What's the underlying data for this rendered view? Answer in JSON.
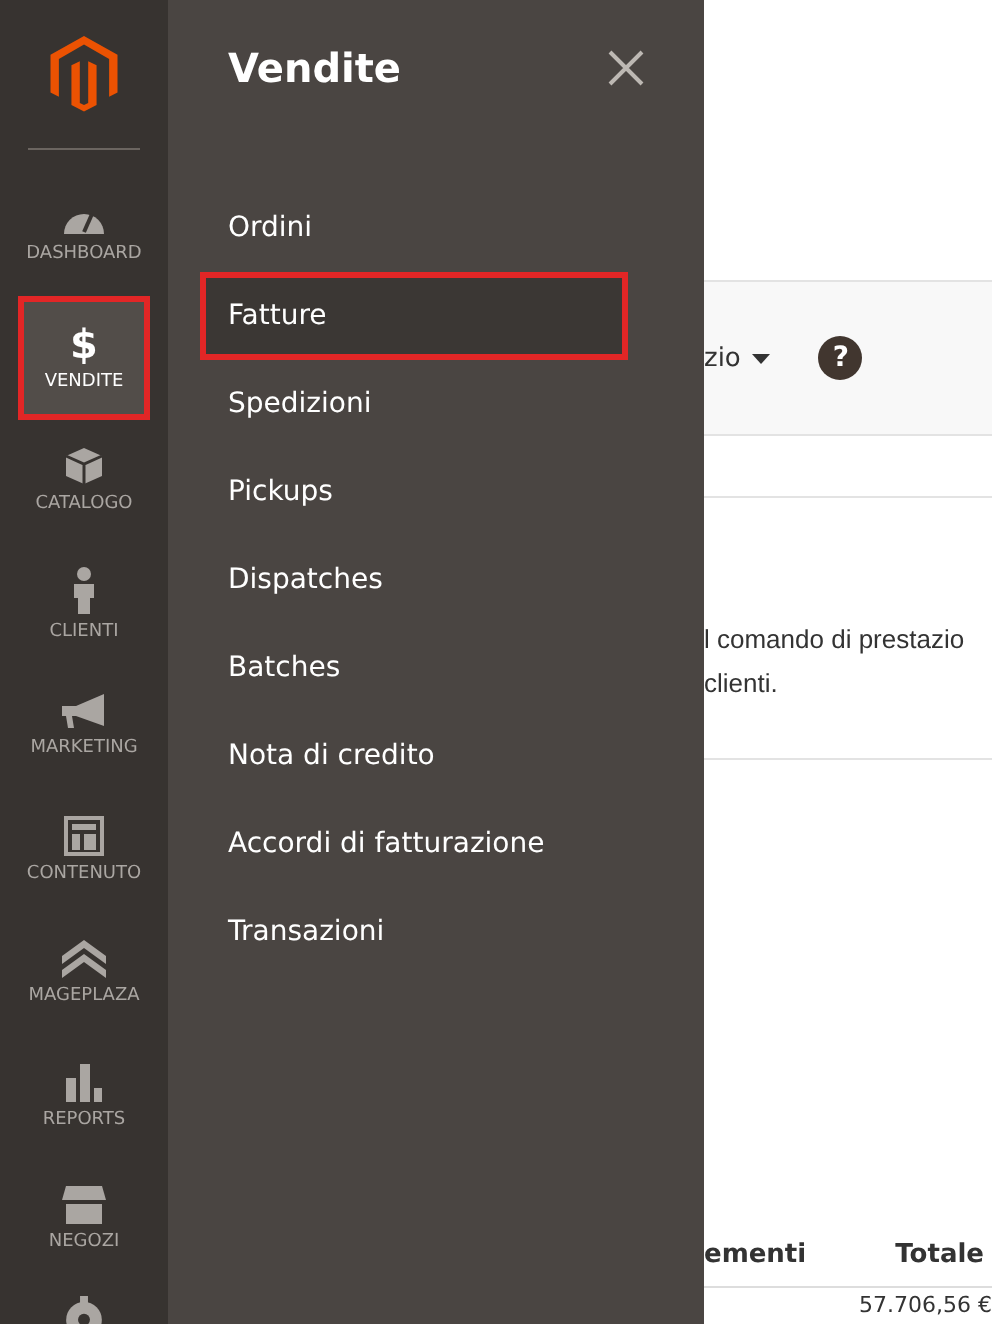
{
  "sidebar": {
    "items": [
      {
        "label": "DASHBOARD",
        "kind": "gauge",
        "selected": false
      },
      {
        "label": "VENDITE",
        "kind": "glyph",
        "glyph": "$",
        "selected": true
      },
      {
        "label": "CATALOGO",
        "kind": "box",
        "selected": false
      },
      {
        "label": "CLIENTI",
        "kind": "person",
        "selected": false
      },
      {
        "label": "MARKETING",
        "kind": "megaphone",
        "selected": false
      },
      {
        "label": "CONTENUTO",
        "kind": "layout",
        "selected": false
      },
      {
        "label": "MAGEPLAZA",
        "kind": "chevrons",
        "selected": false
      },
      {
        "label": "REPORTS",
        "kind": "bars",
        "selected": false
      },
      {
        "label": "NEGOZI",
        "kind": "store",
        "selected": false
      }
    ]
  },
  "menu": {
    "title": "Vendite",
    "items": [
      {
        "label": "Ordini",
        "selected": false
      },
      {
        "label": "Fatture",
        "selected": true
      },
      {
        "label": "Spedizioni",
        "selected": false
      },
      {
        "label": "Pickups",
        "selected": false
      },
      {
        "label": "Dispatches",
        "selected": false
      },
      {
        "label": "Batches",
        "selected": false
      },
      {
        "label": "Nota di credito",
        "selected": false
      },
      {
        "label": "Accordi di fatturazione",
        "selected": false
      },
      {
        "label": "Transazioni",
        "selected": false
      }
    ]
  },
  "content": {
    "dropdown": "zio",
    "help": "?",
    "message_lines": [
      "l comando di prestazio",
      "clienti."
    ],
    "table": {
      "columns": [
        "ementi",
        "Totale"
      ],
      "cell": "57.706,56 €"
    }
  }
}
